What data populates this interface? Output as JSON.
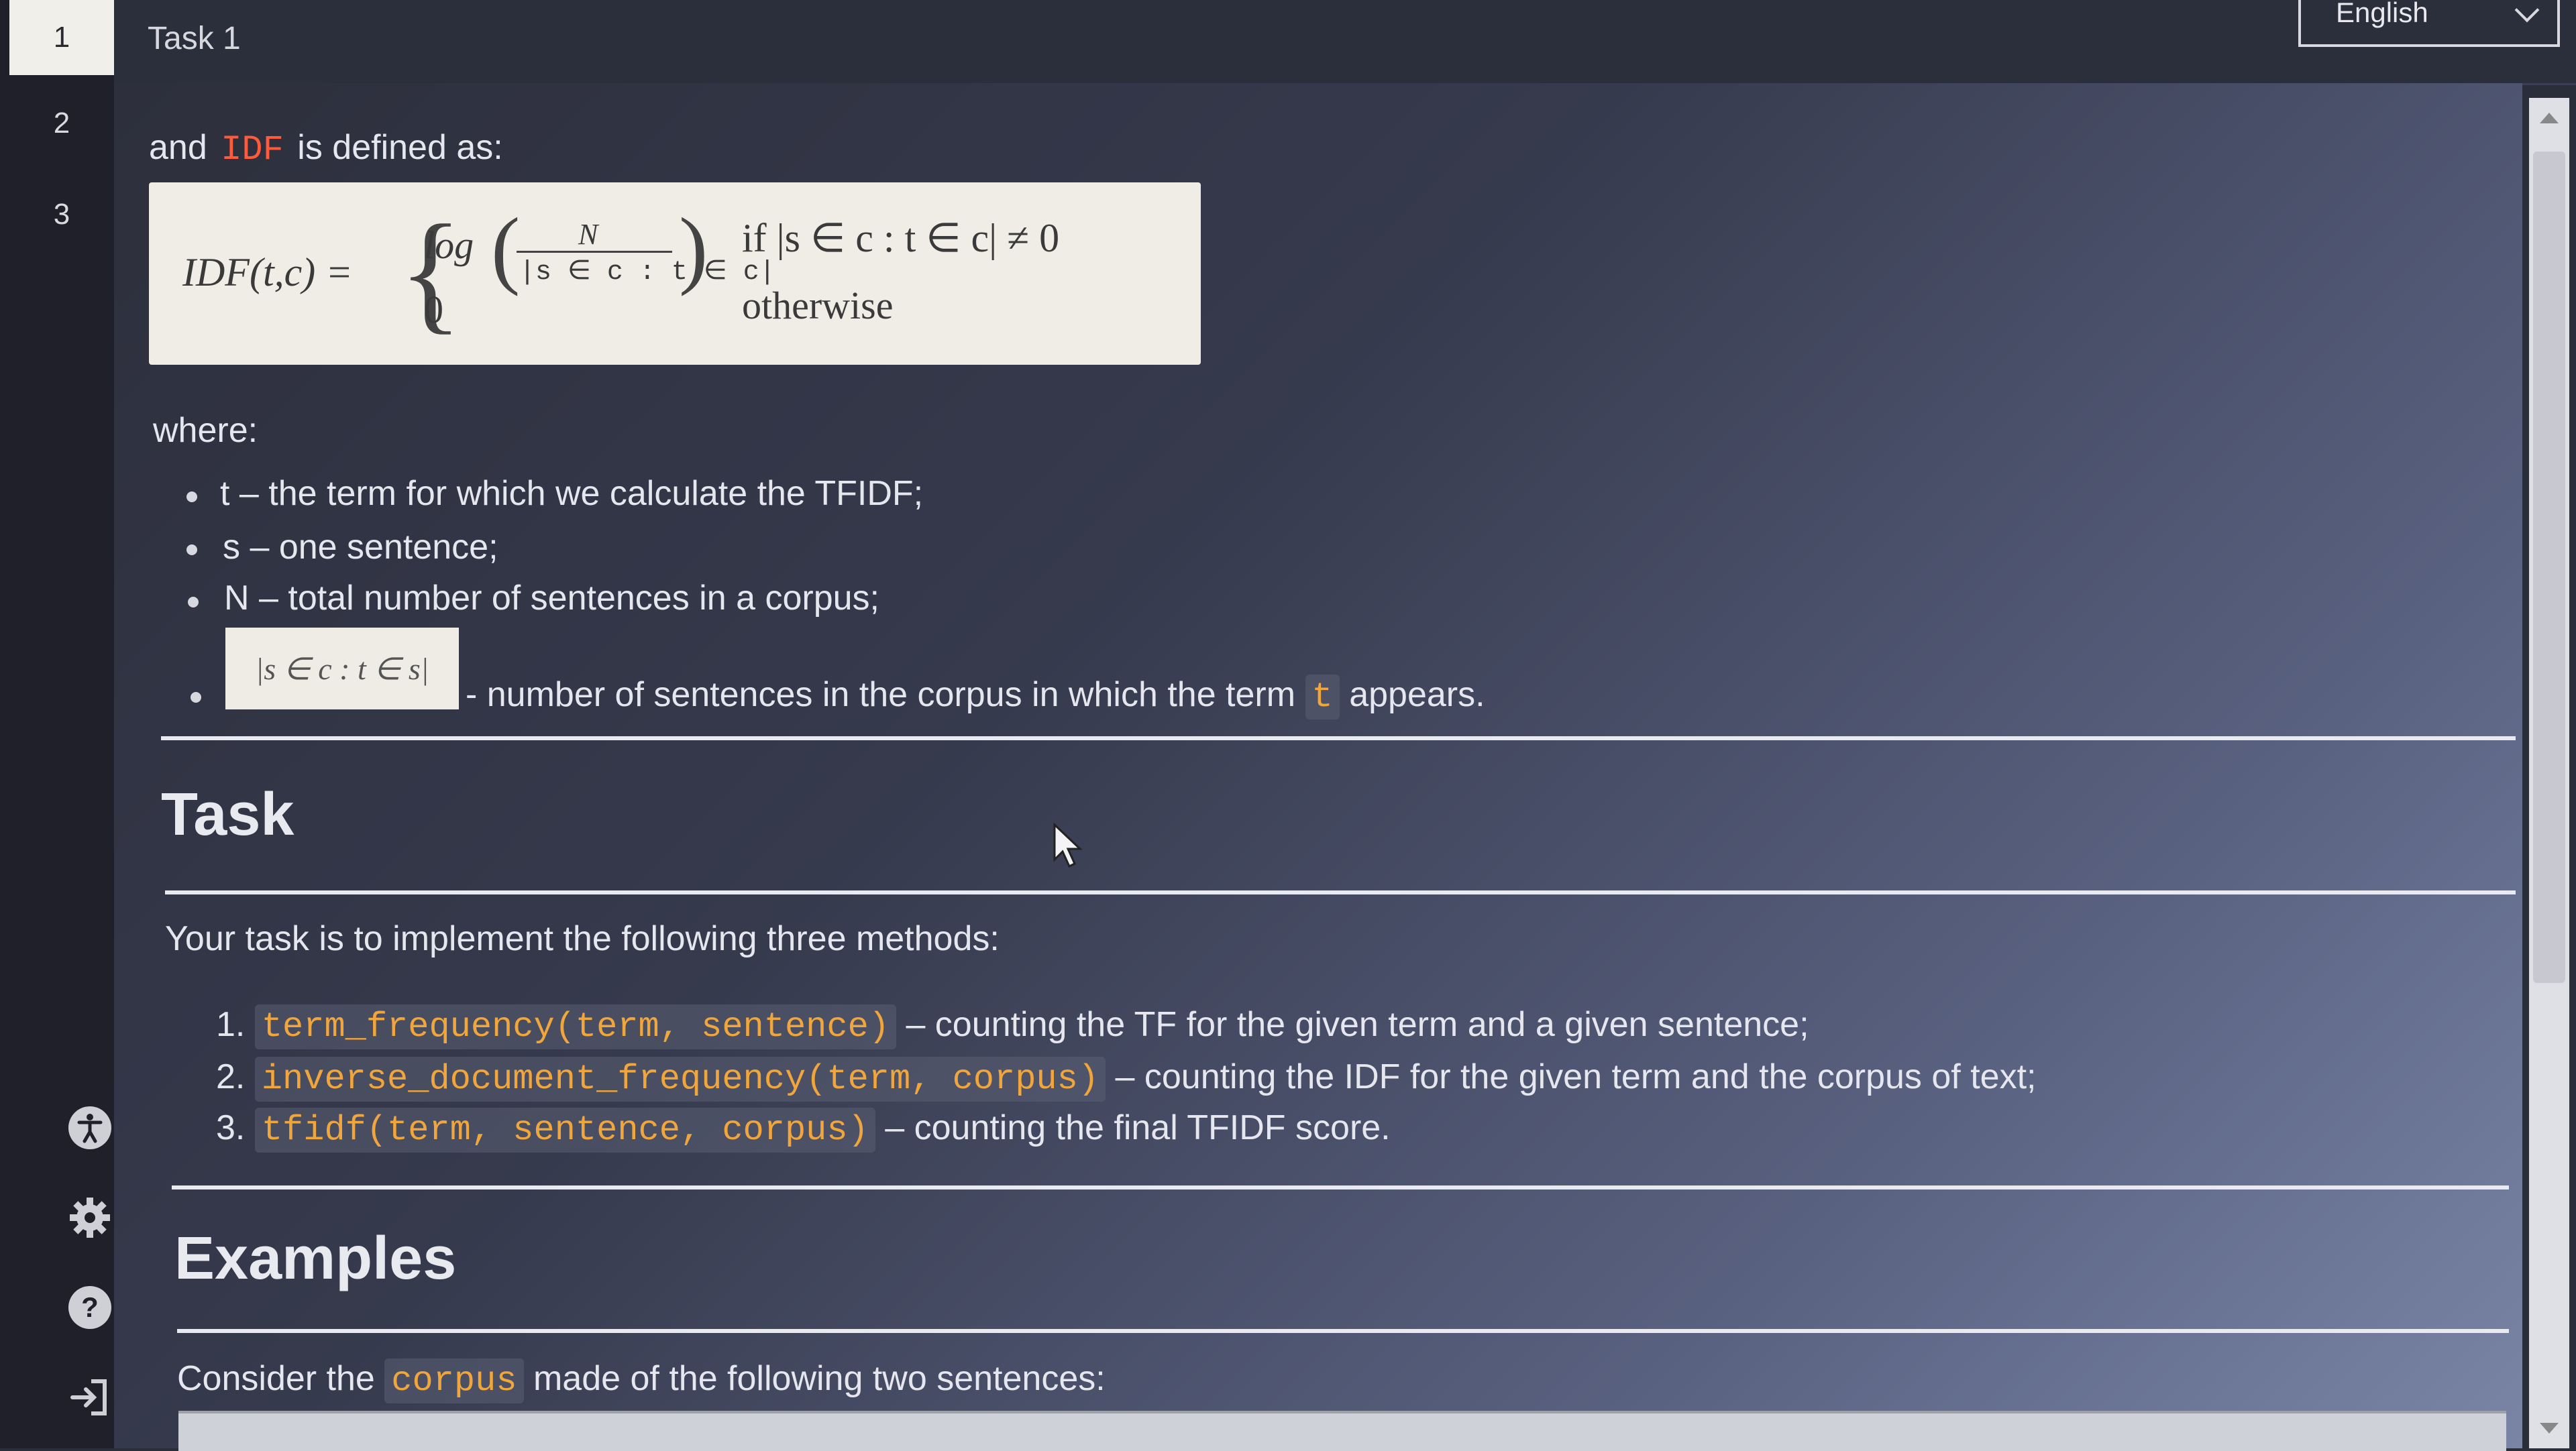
{
  "sidebar": {
    "numbers": [
      "1",
      "2",
      "3"
    ],
    "icons": [
      "accessibility-icon",
      "settings-icon",
      "help-icon",
      "logout-icon"
    ]
  },
  "header": {
    "task_title": "Task 1",
    "language": "English"
  },
  "intro": {
    "before": "and",
    "term": "IDF",
    "after": "is defined as:"
  },
  "formula": {
    "lhs": "IDF(t,c) =",
    "log": "log",
    "numerator": "N",
    "denominator": "|s ∈ c : t ∈ c|",
    "zero": "0",
    "condition_1": "if |s ∈ c : t ∈ c| ≠ 0",
    "condition_2": "otherwise"
  },
  "where": {
    "label": "where:",
    "items": [
      "t – the term for which we calculate the TFIDF;",
      "s – one sentence;",
      "N – total number of sentences in a corpus;"
    ],
    "last_item_math": "|s ∈ c : t ∈ s|",
    "last_item_text_before": "- number of sentences in the corpus in which the term",
    "last_item_code": "t",
    "last_item_text_after": "appears."
  },
  "task": {
    "heading": "Task",
    "intro": "Your task is to implement the following three methods:",
    "methods": [
      {
        "num": "1.",
        "code": "term_frequency(term, sentence)",
        "desc": "– counting the TF for the given term and a given sentence;"
      },
      {
        "num": "2.",
        "code": "inverse_document_frequency(term, corpus)",
        "desc": "– counting the IDF for the given term and the corpus of text;"
      },
      {
        "num": "3.",
        "code": "tfidf(term, sentence, corpus)",
        "desc": "– counting the final TFIDF score."
      }
    ]
  },
  "examples": {
    "heading": "Examples",
    "before": "Consider the",
    "code": "corpus",
    "after": "made of the following two sentences:"
  }
}
